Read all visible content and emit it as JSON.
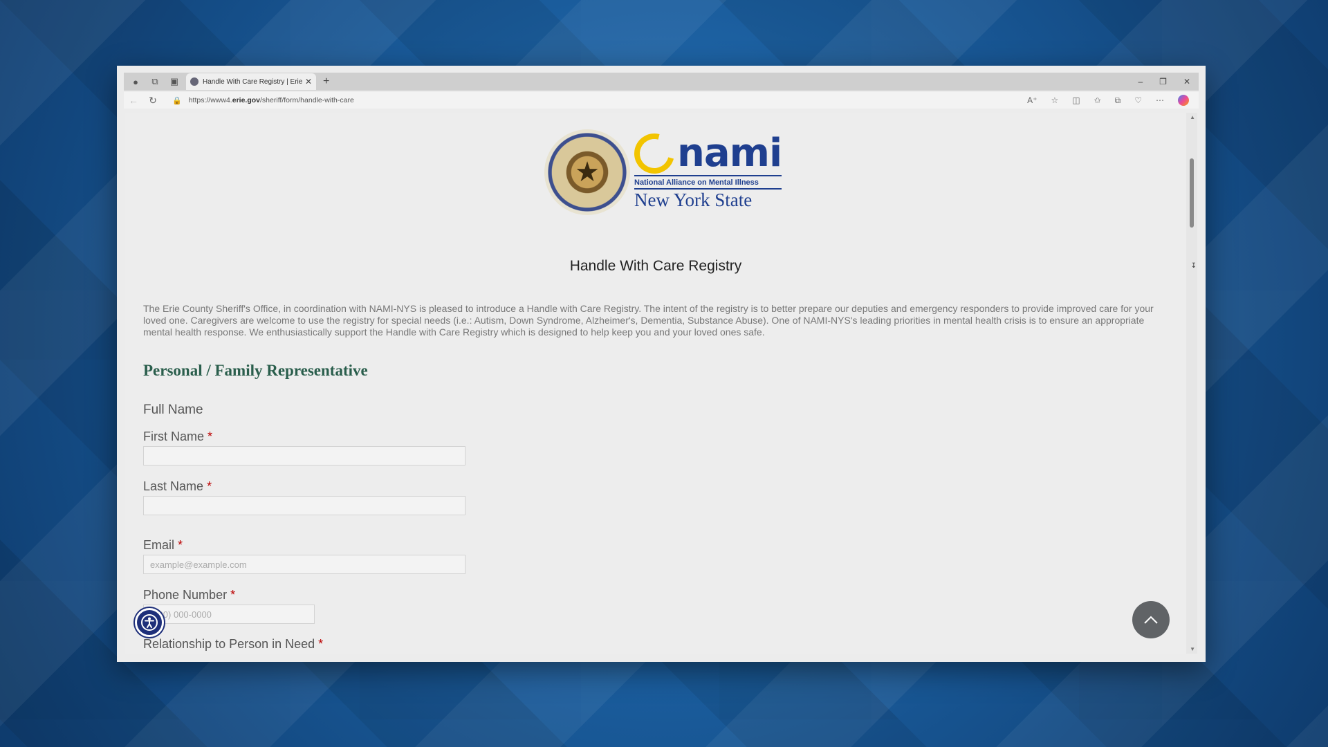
{
  "browser": {
    "tab_title": "Handle With Care Registry | Erie C",
    "url_prefix": "https://www4.",
    "url_domain": "erie.gov",
    "url_path": "/sheriff/form/handle-with-care"
  },
  "logo": {
    "nami_word": "nami",
    "nami_subtitle": "National Alliance on Mental Illness",
    "nami_state": "New York State"
  },
  "page": {
    "title": "Handle With Care Registry",
    "intro": "The Erie County Sheriff's Office, in coordination with NAMI-NYS is pleased to introduce a Handle with Care Registry. The intent of the registry is to better prepare our deputies and emergency responders to provide improved care for your loved one. Caregivers are welcome to use the registry for special needs (i.e.: Autism, Down Syndrome, Alzheimer's, Dementia, Substance Abuse). One of NAMI-NYS's leading priorities in mental health crisis is to ensure an appropriate mental health response. We enthusiastically support the Handle with Care Registry which is designed to help keep you and your loved ones safe."
  },
  "form": {
    "section_heading": "Personal / Family Representative",
    "full_name_label": "Full Name",
    "first_name_label": "First Name",
    "last_name_label": "Last Name",
    "email_label": "Email",
    "email_placeholder": "example@example.com",
    "phone_label": "Phone Number",
    "phone_placeholder": "(000) 000-0000",
    "relationship_label": "Relationship to Person in Need",
    "required_marker": "*"
  }
}
